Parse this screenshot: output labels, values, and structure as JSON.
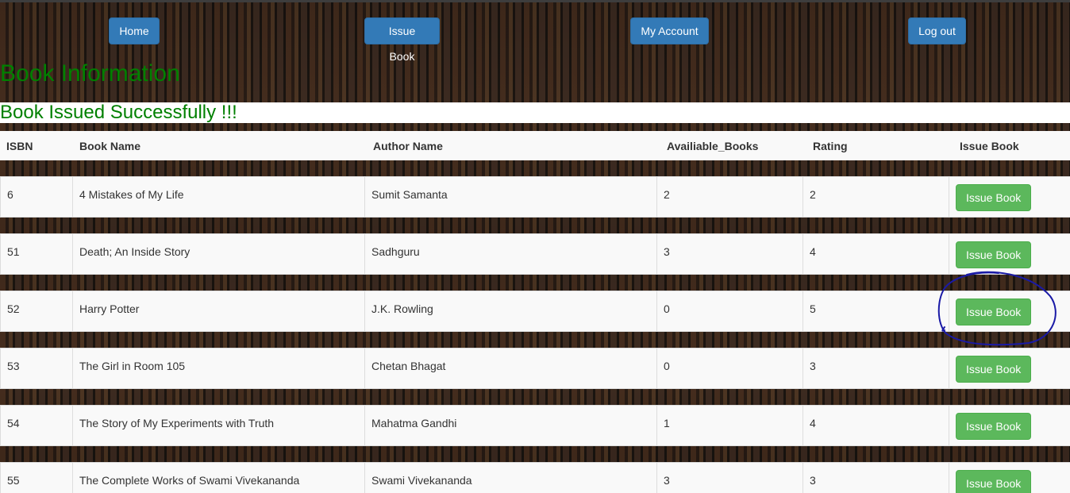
{
  "nav": {
    "home": "Home",
    "issue_book": "Issue Book",
    "my_account": "My Account",
    "logout": "Log out"
  },
  "page_title": "Book Information",
  "status_message": "Book Issued Successfully !!!",
  "table": {
    "headers": [
      "ISBN",
      "Book Name",
      "Author Name",
      "Availiable_Books",
      "Rating",
      "Issue Book"
    ],
    "rows": [
      {
        "isbn": "6",
        "name": "4 Mistakes of My Life",
        "author": "Sumit Samanta",
        "available": "2",
        "rating": "2",
        "action": "Issue Book"
      },
      {
        "isbn": "51",
        "name": "Death; An Inside Story",
        "author": "Sadhguru",
        "available": "3",
        "rating": "4",
        "action": "Issue Book"
      },
      {
        "isbn": "52",
        "name": "Harry Potter",
        "author": "J.K. Rowling",
        "available": "0",
        "rating": "5",
        "action": "Issue Book"
      },
      {
        "isbn": "53",
        "name": "The Girl in Room 105",
        "author": "Chetan Bhagat",
        "available": "0",
        "rating": "3",
        "action": "Issue Book"
      },
      {
        "isbn": "54",
        "name": "The Story of My Experiments with Truth",
        "author": "Mahatma Gandhi",
        "available": "1",
        "rating": "4",
        "action": "Issue Book"
      },
      {
        "isbn": "55",
        "name": "The Complete Works of Swami Vivekananda",
        "author": "Swami Vivekananda",
        "available": "3",
        "rating": "3",
        "action": "Issue Book"
      }
    ]
  },
  "colors": {
    "nav_button": "#337ab7",
    "issue_button": "#5cb85c",
    "title_green": "#008000",
    "annotation": "#1a1aa6"
  }
}
